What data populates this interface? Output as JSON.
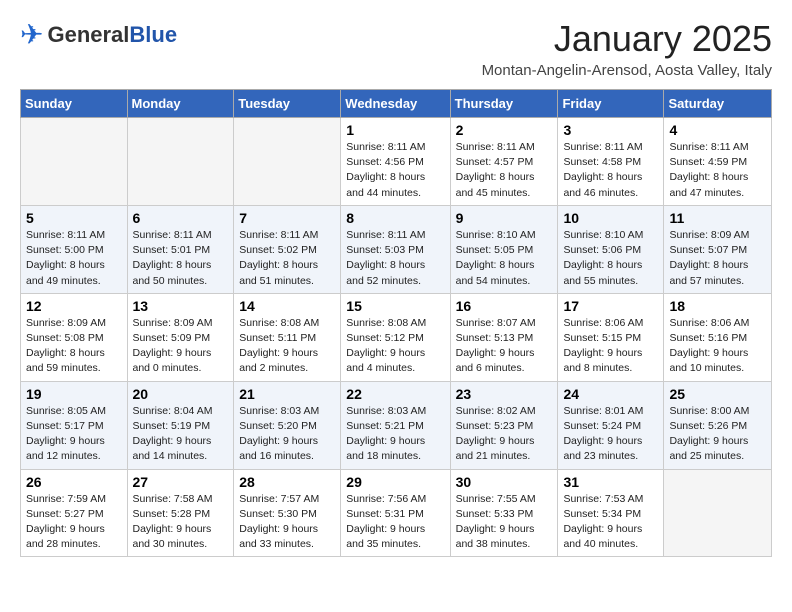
{
  "header": {
    "logo_general": "General",
    "logo_blue": "Blue",
    "month_title": "January 2025",
    "location": "Montan-Angelin-Arensod, Aosta Valley, Italy"
  },
  "days_of_week": [
    "Sunday",
    "Monday",
    "Tuesday",
    "Wednesday",
    "Thursday",
    "Friday",
    "Saturday"
  ],
  "weeks": [
    [
      {
        "day": "",
        "info": ""
      },
      {
        "day": "",
        "info": ""
      },
      {
        "day": "",
        "info": ""
      },
      {
        "day": "1",
        "info": "Sunrise: 8:11 AM\nSunset: 4:56 PM\nDaylight: 8 hours\nand 44 minutes."
      },
      {
        "day": "2",
        "info": "Sunrise: 8:11 AM\nSunset: 4:57 PM\nDaylight: 8 hours\nand 45 minutes."
      },
      {
        "day": "3",
        "info": "Sunrise: 8:11 AM\nSunset: 4:58 PM\nDaylight: 8 hours\nand 46 minutes."
      },
      {
        "day": "4",
        "info": "Sunrise: 8:11 AM\nSunset: 4:59 PM\nDaylight: 8 hours\nand 47 minutes."
      }
    ],
    [
      {
        "day": "5",
        "info": "Sunrise: 8:11 AM\nSunset: 5:00 PM\nDaylight: 8 hours\nand 49 minutes."
      },
      {
        "day": "6",
        "info": "Sunrise: 8:11 AM\nSunset: 5:01 PM\nDaylight: 8 hours\nand 50 minutes."
      },
      {
        "day": "7",
        "info": "Sunrise: 8:11 AM\nSunset: 5:02 PM\nDaylight: 8 hours\nand 51 minutes."
      },
      {
        "day": "8",
        "info": "Sunrise: 8:11 AM\nSunset: 5:03 PM\nDaylight: 8 hours\nand 52 minutes."
      },
      {
        "day": "9",
        "info": "Sunrise: 8:10 AM\nSunset: 5:05 PM\nDaylight: 8 hours\nand 54 minutes."
      },
      {
        "day": "10",
        "info": "Sunrise: 8:10 AM\nSunset: 5:06 PM\nDaylight: 8 hours\nand 55 minutes."
      },
      {
        "day": "11",
        "info": "Sunrise: 8:09 AM\nSunset: 5:07 PM\nDaylight: 8 hours\nand 57 minutes."
      }
    ],
    [
      {
        "day": "12",
        "info": "Sunrise: 8:09 AM\nSunset: 5:08 PM\nDaylight: 8 hours\nand 59 minutes."
      },
      {
        "day": "13",
        "info": "Sunrise: 8:09 AM\nSunset: 5:09 PM\nDaylight: 9 hours\nand 0 minutes."
      },
      {
        "day": "14",
        "info": "Sunrise: 8:08 AM\nSunset: 5:11 PM\nDaylight: 9 hours\nand 2 minutes."
      },
      {
        "day": "15",
        "info": "Sunrise: 8:08 AM\nSunset: 5:12 PM\nDaylight: 9 hours\nand 4 minutes."
      },
      {
        "day": "16",
        "info": "Sunrise: 8:07 AM\nSunset: 5:13 PM\nDaylight: 9 hours\nand 6 minutes."
      },
      {
        "day": "17",
        "info": "Sunrise: 8:06 AM\nSunset: 5:15 PM\nDaylight: 9 hours\nand 8 minutes."
      },
      {
        "day": "18",
        "info": "Sunrise: 8:06 AM\nSunset: 5:16 PM\nDaylight: 9 hours\nand 10 minutes."
      }
    ],
    [
      {
        "day": "19",
        "info": "Sunrise: 8:05 AM\nSunset: 5:17 PM\nDaylight: 9 hours\nand 12 minutes."
      },
      {
        "day": "20",
        "info": "Sunrise: 8:04 AM\nSunset: 5:19 PM\nDaylight: 9 hours\nand 14 minutes."
      },
      {
        "day": "21",
        "info": "Sunrise: 8:03 AM\nSunset: 5:20 PM\nDaylight: 9 hours\nand 16 minutes."
      },
      {
        "day": "22",
        "info": "Sunrise: 8:03 AM\nSunset: 5:21 PM\nDaylight: 9 hours\nand 18 minutes."
      },
      {
        "day": "23",
        "info": "Sunrise: 8:02 AM\nSunset: 5:23 PM\nDaylight: 9 hours\nand 21 minutes."
      },
      {
        "day": "24",
        "info": "Sunrise: 8:01 AM\nSunset: 5:24 PM\nDaylight: 9 hours\nand 23 minutes."
      },
      {
        "day": "25",
        "info": "Sunrise: 8:00 AM\nSunset: 5:26 PM\nDaylight: 9 hours\nand 25 minutes."
      }
    ],
    [
      {
        "day": "26",
        "info": "Sunrise: 7:59 AM\nSunset: 5:27 PM\nDaylight: 9 hours\nand 28 minutes."
      },
      {
        "day": "27",
        "info": "Sunrise: 7:58 AM\nSunset: 5:28 PM\nDaylight: 9 hours\nand 30 minutes."
      },
      {
        "day": "28",
        "info": "Sunrise: 7:57 AM\nSunset: 5:30 PM\nDaylight: 9 hours\nand 33 minutes."
      },
      {
        "day": "29",
        "info": "Sunrise: 7:56 AM\nSunset: 5:31 PM\nDaylight: 9 hours\nand 35 minutes."
      },
      {
        "day": "30",
        "info": "Sunrise: 7:55 AM\nSunset: 5:33 PM\nDaylight: 9 hours\nand 38 minutes."
      },
      {
        "day": "31",
        "info": "Sunrise: 7:53 AM\nSunset: 5:34 PM\nDaylight: 9 hours\nand 40 minutes."
      },
      {
        "day": "",
        "info": ""
      }
    ]
  ]
}
